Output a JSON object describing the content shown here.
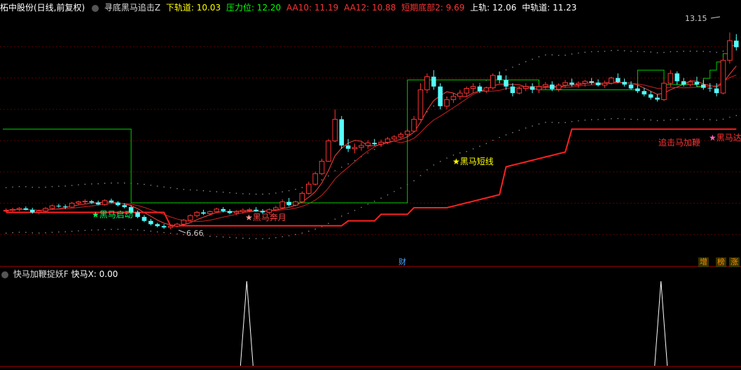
{
  "header": {
    "stock_name": "柘中股份(日线,前复权)",
    "indicator_name": "寻底黑马追击Z",
    "lower_track": "下轨道: 10.03",
    "pressure": "压力位: 12.20",
    "aa10": "AA10: 11.19",
    "aa12": "AA12: 10.88",
    "short_bottom": "短期底部2: 9.69",
    "upper_track": "上轨: 12.06",
    "middle_track": "中轨道: 11.23",
    "colors": {
      "lower": "#ffff00",
      "pressure": "#00ff00",
      "aa": "#ff3333",
      "short": "#ff3333",
      "upper": "#ffffff",
      "middle": "#ffffff"
    }
  },
  "annotations": {
    "high_price": "13.15",
    "low_price": "6.66",
    "label_black_horse_ready": "黑马启动",
    "label_black_horse_moon": "黑马奔月",
    "label_black_horse_short": "黑马短线",
    "label_chase_whip": "追击马加鞭",
    "label_black_horse_right": "黑马达"
  },
  "badges": {
    "cai": "财",
    "zeng": "增",
    "bang": "榜",
    "zhang": "涨"
  },
  "sub_header": {
    "indicator_name": "快马加鞭捉妖F",
    "value": "快马X: 0.00"
  },
  "chart_data": {
    "type": "candlestick",
    "ylim": [
      6.2,
      13.5
    ],
    "candles": [
      [
        7.7,
        7.78,
        7.66,
        7.72
      ],
      [
        7.72,
        7.8,
        7.68,
        7.75
      ],
      [
        7.75,
        7.82,
        7.7,
        7.78
      ],
      [
        7.78,
        7.84,
        7.72,
        7.74
      ],
      [
        7.74,
        7.8,
        7.62,
        7.66
      ],
      [
        7.66,
        7.74,
        7.6,
        7.7
      ],
      [
        7.7,
        7.82,
        7.66,
        7.78
      ],
      [
        7.78,
        7.9,
        7.74,
        7.86
      ],
      [
        7.86,
        7.92,
        7.8,
        7.84
      ],
      [
        7.84,
        7.9,
        7.76,
        7.82
      ],
      [
        7.82,
        7.98,
        7.8,
        7.94
      ],
      [
        7.94,
        8.02,
        7.9,
        7.98
      ],
      [
        7.98,
        8.06,
        7.92,
        8.0
      ],
      [
        8.0,
        8.04,
        7.92,
        7.96
      ],
      [
        7.96,
        8.02,
        7.88,
        7.9
      ],
      [
        7.9,
        8.06,
        7.86,
        8.02
      ],
      [
        8.02,
        8.08,
        7.94,
        7.96
      ],
      [
        7.96,
        8.0,
        7.84,
        7.88
      ],
      [
        7.88,
        7.94,
        7.78,
        7.82
      ],
      [
        7.82,
        7.88,
        7.62,
        7.66
      ],
      [
        7.66,
        7.72,
        7.48,
        7.52
      ],
      [
        7.52,
        7.58,
        7.36,
        7.4
      ],
      [
        7.4,
        7.46,
        7.26,
        7.3
      ],
      [
        7.3,
        7.34,
        7.2,
        7.24
      ],
      [
        7.24,
        7.3,
        7.16,
        7.2
      ],
      [
        7.2,
        7.28,
        7.14,
        7.24
      ],
      [
        7.24,
        7.34,
        7.2,
        7.3
      ],
      [
        7.3,
        7.46,
        7.26,
        7.42
      ],
      [
        7.42,
        7.6,
        7.38,
        7.56
      ],
      [
        7.56,
        7.7,
        7.5,
        7.66
      ],
      [
        7.66,
        7.74,
        7.58,
        7.62
      ],
      [
        7.62,
        7.72,
        7.56,
        7.68
      ],
      [
        7.68,
        7.8,
        7.64,
        7.76
      ],
      [
        7.76,
        7.82,
        7.66,
        7.7
      ],
      [
        7.7,
        7.76,
        7.6,
        7.64
      ],
      [
        7.64,
        7.72,
        7.58,
        7.68
      ],
      [
        7.68,
        7.78,
        7.62,
        7.72
      ],
      [
        7.72,
        7.8,
        7.66,
        7.74
      ],
      [
        7.74,
        7.82,
        7.68,
        7.7
      ],
      [
        7.7,
        7.76,
        7.62,
        7.66
      ],
      [
        7.66,
        7.78,
        7.6,
        7.74
      ],
      [
        7.74,
        7.86,
        7.7,
        7.8
      ],
      [
        7.8,
        8.06,
        7.76,
        7.98
      ],
      [
        7.98,
        8.1,
        7.84,
        7.88
      ],
      [
        7.88,
        8.02,
        7.84,
        7.98
      ],
      [
        7.98,
        8.3,
        7.94,
        8.24
      ],
      [
        8.24,
        8.6,
        8.2,
        8.52
      ],
      [
        8.52,
        8.9,
        8.48,
        8.84
      ],
      [
        8.84,
        9.3,
        8.8,
        9.22
      ],
      [
        9.22,
        9.9,
        9.2,
        9.84
      ],
      [
        9.84,
        10.8,
        9.8,
        10.5
      ],
      [
        10.5,
        10.6,
        9.6,
        9.7
      ],
      [
        9.7,
        9.9,
        9.5,
        9.6
      ],
      [
        9.6,
        9.76,
        9.46,
        9.64
      ],
      [
        9.64,
        9.8,
        9.54,
        9.7
      ],
      [
        9.7,
        9.86,
        9.6,
        9.78
      ],
      [
        9.78,
        9.9,
        9.7,
        9.74
      ],
      [
        9.74,
        9.88,
        9.66,
        9.8
      ],
      [
        9.8,
        9.96,
        9.74,
        9.9
      ],
      [
        9.9,
        10.02,
        9.84,
        9.96
      ],
      [
        9.96,
        10.1,
        9.9,
        10.04
      ],
      [
        10.04,
        10.2,
        9.98,
        10.14
      ],
      [
        10.14,
        10.6,
        10.1,
        10.5
      ],
      [
        10.5,
        11.6,
        10.46,
        11.4
      ],
      [
        11.4,
        11.9,
        11.3,
        11.8
      ],
      [
        11.8,
        12.0,
        11.4,
        11.5
      ],
      [
        11.5,
        11.6,
        10.8,
        10.9
      ],
      [
        10.9,
        11.2,
        10.8,
        11.1
      ],
      [
        11.1,
        11.3,
        11.0,
        11.2
      ],
      [
        11.2,
        11.4,
        11.1,
        11.3
      ],
      [
        11.3,
        11.5,
        11.2,
        11.44
      ],
      [
        11.44,
        11.6,
        11.3,
        11.5
      ],
      [
        11.5,
        11.56,
        11.3,
        11.36
      ],
      [
        11.36,
        11.5,
        11.3,
        11.46
      ],
      [
        11.46,
        11.9,
        11.4,
        11.84
      ],
      [
        11.84,
        11.96,
        11.6,
        11.7
      ],
      [
        11.7,
        11.84,
        11.4,
        11.5
      ],
      [
        11.5,
        11.6,
        11.2,
        11.3
      ],
      [
        11.3,
        11.5,
        11.26,
        11.44
      ],
      [
        11.44,
        11.6,
        11.36,
        11.5
      ],
      [
        11.5,
        11.6,
        11.3,
        11.4
      ],
      [
        11.4,
        11.56,
        11.3,
        11.5
      ],
      [
        11.5,
        11.64,
        11.4,
        11.56
      ],
      [
        11.56,
        11.66,
        11.36,
        11.42
      ],
      [
        11.42,
        11.6,
        11.34,
        11.54
      ],
      [
        11.54,
        11.7,
        11.46,
        11.62
      ],
      [
        11.62,
        11.74,
        11.5,
        11.56
      ],
      [
        11.56,
        11.66,
        11.46,
        11.6
      ],
      [
        11.6,
        11.7,
        11.5,
        11.66
      ],
      [
        11.66,
        11.76,
        11.56,
        11.62
      ],
      [
        11.62,
        11.72,
        11.5,
        11.54
      ],
      [
        11.54,
        11.68,
        11.46,
        11.6
      ],
      [
        11.6,
        11.8,
        11.56,
        11.76
      ],
      [
        11.76,
        11.9,
        11.6,
        11.64
      ],
      [
        11.64,
        11.74,
        11.5,
        11.56
      ],
      [
        11.56,
        11.66,
        11.4,
        11.44
      ],
      [
        11.44,
        11.54,
        11.3,
        11.36
      ],
      [
        11.36,
        11.46,
        11.2,
        11.26
      ],
      [
        11.26,
        11.36,
        11.1,
        11.16
      ],
      [
        11.16,
        11.26,
        11.04,
        11.1
      ],
      [
        11.1,
        11.7,
        11.06,
        11.6
      ],
      [
        11.6,
        12.0,
        11.5,
        11.9
      ],
      [
        11.9,
        11.96,
        11.56,
        11.66
      ],
      [
        11.66,
        11.76,
        11.5,
        11.56
      ],
      [
        11.56,
        11.7,
        11.5,
        11.64
      ],
      [
        11.64,
        11.8,
        11.5,
        11.56
      ],
      [
        11.56,
        11.7,
        11.4,
        11.46
      ],
      [
        11.46,
        11.6,
        11.34,
        11.44
      ],
      [
        11.44,
        11.6,
        11.2,
        11.3
      ],
      [
        11.3,
        12.4,
        11.26,
        12.3
      ],
      [
        12.3,
        13.15,
        12.2,
        12.9
      ],
      [
        12.9,
        13.1,
        12.6,
        12.7
      ]
    ]
  },
  "sub_chart_data": {
    "type": "line",
    "spike_positions": [
      0.333,
      0.892
    ]
  }
}
